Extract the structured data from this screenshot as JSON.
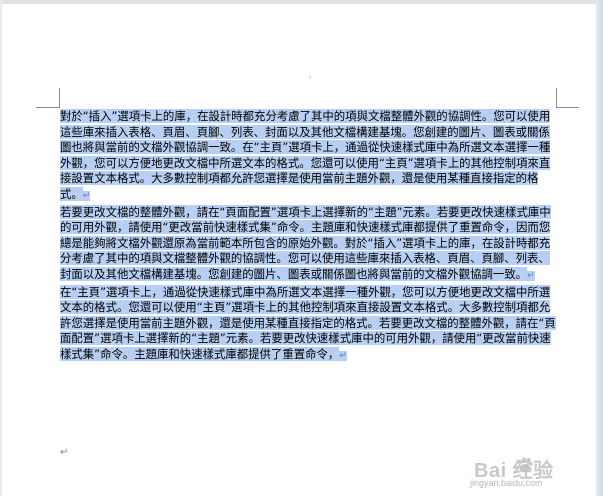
{
  "header_mark": "·",
  "paragraphs": [
    {
      "text": "對於“插入”選項卡上的庫，在設計時都充分考慮了其中的項與文檔整體外觀的協調性。您可以使用這些庫來插入表格、頁眉、頁腳、列表、封面以及其他文檔構建基塊。您創建的圖片、圖表或關係圖也將與當前的文檔外觀協調一致。在“主頁”選項卡上，通過從快速樣式庫中為所選文本選擇一種外觀，您可以方便地更改文檔中所選文本的格式。您還可以使用“主頁”選項卡上的其他控制項來直接設置文本格式。大多數控制項都允許您選擇是使用當前主題外觀，還是使用某種直接指定的格式。",
      "mark": "↵"
    },
    {
      "text": "若要更改文檔的整體外觀，請在“頁面配置”選項卡上選擇新的“主題”元素。若要更改快速樣式庫中的可用外觀，請使用“更改當前快速樣式集”命令。主題庫和快速樣式庫都提供了重置命令，因而您總是能夠將文檔外觀還原為當前範本所包含的原始外觀。對於“插入”選項卡上的庫，在設計時都充分考慮了其中的項與文檔整體外觀的協調性。您可以使用這些庫來插入表格、頁眉、頁腳、列表、封面以及其他文檔構建基塊。您創建的圖片、圖表或關係圖也將與當前的文檔外觀協調一致。",
      "mark": "↵"
    },
    {
      "text": "在“主頁”選項卡上，通過從快速樣式庫中為所選文本選擇一種外觀，您可以方便地更改文檔中所選文本的格式。您還可以使用“主頁”選項卡上的其他控制項來直接設置文本格式。大多數控制項都允許您選擇是使用當前主題外觀，還是使用某種直接指定的格式。若要更改文檔的整體外觀，請在“頁面配置”選項卡上選擇新的“主題”元素。若要更改快速樣式庫中的可用外觀，請使用“更改當前快速樣式集”命令。主題庫和快速樣式庫都提供了重置命令，",
      "mark": "↵"
    }
  ],
  "final_mark": "↵",
  "watermark": {
    "brand": "Bai  经验",
    "sub": "jingyan.baidu.com"
  }
}
